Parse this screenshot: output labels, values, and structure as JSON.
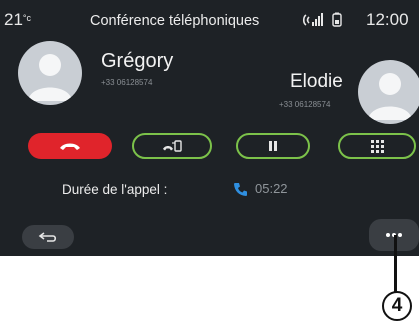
{
  "status_bar": {
    "temperature": "21",
    "temperature_unit": "°c",
    "title": "Conférence téléphoniques",
    "time": "12:00"
  },
  "participants": [
    {
      "name": "Grégory",
      "number": "+33 06128574"
    },
    {
      "name": "Elodie",
      "number": "+33 06128574"
    }
  ],
  "call_controls": [
    {
      "name": "hang-up",
      "icon": "phone-hangup-icon"
    },
    {
      "name": "transfer",
      "icon": "phone-transfer-icon"
    },
    {
      "name": "hold",
      "icon": "pause-icon"
    },
    {
      "name": "keypad",
      "icon": "keypad-icon"
    }
  ],
  "call_info": {
    "duration_label": "Durée de l'appel :",
    "duration_icon": "phone-icon",
    "duration_value": "05:22"
  },
  "bottom_bar": {
    "back_icon": "back-arrow-icon",
    "more_icon": "more-options-icon"
  },
  "annotation": {
    "callout_number": "4"
  },
  "colors": {
    "background": "#1e2226",
    "hangup_red": "#e0242b",
    "outline_green": "#7cc24a",
    "accent_blue": "#2f8fe0"
  }
}
